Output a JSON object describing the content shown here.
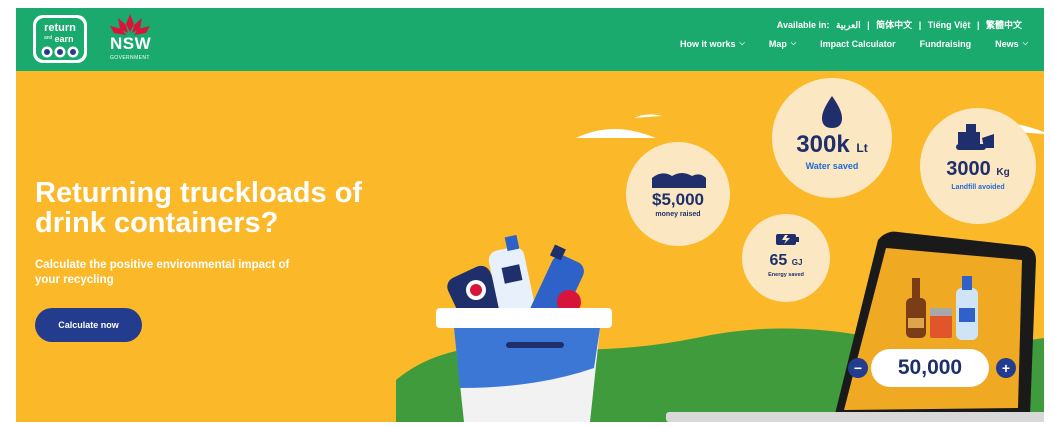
{
  "header": {
    "logo": {
      "line1": "return",
      "line2": "and",
      "line3": "earn",
      "icon": "return-and-earn-logo"
    },
    "gov": {
      "name": "NSW",
      "sub": "GOVERNMENT",
      "icon": "waratah-logo"
    },
    "languages": {
      "label": "Available in:",
      "items": [
        "العربية",
        "|",
        "简体中文",
        "|",
        "Tiếng Việt",
        "|",
        "繁體中文"
      ]
    },
    "nav": [
      {
        "label": "How it works",
        "chevron": true
      },
      {
        "label": "Map",
        "chevron": true
      },
      {
        "label": "Impact Calculator",
        "chevron": false
      },
      {
        "label": "Fundraising",
        "chevron": false
      },
      {
        "label": "News",
        "chevron": true
      }
    ]
  },
  "hero": {
    "title": "Returning truckloads of drink containers?",
    "subtitle": "Calculate the positive environmental impact of your recycling",
    "cta_label": "Calculate now"
  },
  "stats": {
    "money": {
      "value": "$5,000",
      "label": "money raised",
      "icon": "money-icon"
    },
    "water": {
      "value": "300k",
      "unit": "Lt",
      "label": "Water saved",
      "icon": "water-drop-icon"
    },
    "landfill": {
      "value": "3000",
      "unit": "Kg",
      "label": "Landfill avoided",
      "icon": "bulldozer-icon"
    },
    "energy": {
      "value": "65",
      "unit": "GJ",
      "label": "Energy saved",
      "icon": "battery-icon"
    }
  },
  "calculator": {
    "value": "50,000",
    "minus": "−",
    "plus": "+"
  },
  "colors": {
    "header_green": "#1aaa6e",
    "hero_yellow": "#fbb829",
    "navy": "#243c8e",
    "bubble": "#fbe8c2",
    "grass": "#3f9b3c"
  }
}
